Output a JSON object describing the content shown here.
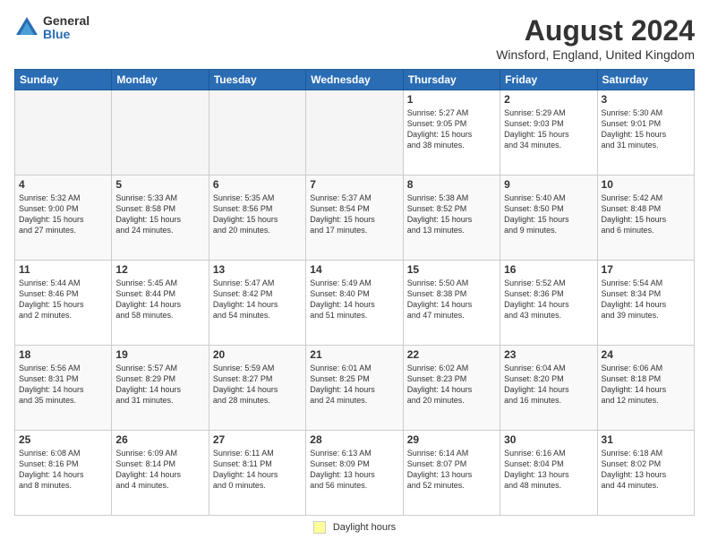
{
  "logo": {
    "general": "General",
    "blue": "Blue"
  },
  "title": "August 2024",
  "subtitle": "Winsford, England, United Kingdom",
  "headers": [
    "Sunday",
    "Monday",
    "Tuesday",
    "Wednesday",
    "Thursday",
    "Friday",
    "Saturday"
  ],
  "legend_label": "Daylight hours",
  "weeks": [
    [
      {
        "day": "",
        "info": ""
      },
      {
        "day": "",
        "info": ""
      },
      {
        "day": "",
        "info": ""
      },
      {
        "day": "",
        "info": ""
      },
      {
        "day": "1",
        "info": "Sunrise: 5:27 AM\nSunset: 9:05 PM\nDaylight: 15 hours\nand 38 minutes."
      },
      {
        "day": "2",
        "info": "Sunrise: 5:29 AM\nSunset: 9:03 PM\nDaylight: 15 hours\nand 34 minutes."
      },
      {
        "day": "3",
        "info": "Sunrise: 5:30 AM\nSunset: 9:01 PM\nDaylight: 15 hours\nand 31 minutes."
      }
    ],
    [
      {
        "day": "4",
        "info": "Sunrise: 5:32 AM\nSunset: 9:00 PM\nDaylight: 15 hours\nand 27 minutes."
      },
      {
        "day": "5",
        "info": "Sunrise: 5:33 AM\nSunset: 8:58 PM\nDaylight: 15 hours\nand 24 minutes."
      },
      {
        "day": "6",
        "info": "Sunrise: 5:35 AM\nSunset: 8:56 PM\nDaylight: 15 hours\nand 20 minutes."
      },
      {
        "day": "7",
        "info": "Sunrise: 5:37 AM\nSunset: 8:54 PM\nDaylight: 15 hours\nand 17 minutes."
      },
      {
        "day": "8",
        "info": "Sunrise: 5:38 AM\nSunset: 8:52 PM\nDaylight: 15 hours\nand 13 minutes."
      },
      {
        "day": "9",
        "info": "Sunrise: 5:40 AM\nSunset: 8:50 PM\nDaylight: 15 hours\nand 9 minutes."
      },
      {
        "day": "10",
        "info": "Sunrise: 5:42 AM\nSunset: 8:48 PM\nDaylight: 15 hours\nand 6 minutes."
      }
    ],
    [
      {
        "day": "11",
        "info": "Sunrise: 5:44 AM\nSunset: 8:46 PM\nDaylight: 15 hours\nand 2 minutes."
      },
      {
        "day": "12",
        "info": "Sunrise: 5:45 AM\nSunset: 8:44 PM\nDaylight: 14 hours\nand 58 minutes."
      },
      {
        "day": "13",
        "info": "Sunrise: 5:47 AM\nSunset: 8:42 PM\nDaylight: 14 hours\nand 54 minutes."
      },
      {
        "day": "14",
        "info": "Sunrise: 5:49 AM\nSunset: 8:40 PM\nDaylight: 14 hours\nand 51 minutes."
      },
      {
        "day": "15",
        "info": "Sunrise: 5:50 AM\nSunset: 8:38 PM\nDaylight: 14 hours\nand 47 minutes."
      },
      {
        "day": "16",
        "info": "Sunrise: 5:52 AM\nSunset: 8:36 PM\nDaylight: 14 hours\nand 43 minutes."
      },
      {
        "day": "17",
        "info": "Sunrise: 5:54 AM\nSunset: 8:34 PM\nDaylight: 14 hours\nand 39 minutes."
      }
    ],
    [
      {
        "day": "18",
        "info": "Sunrise: 5:56 AM\nSunset: 8:31 PM\nDaylight: 14 hours\nand 35 minutes."
      },
      {
        "day": "19",
        "info": "Sunrise: 5:57 AM\nSunset: 8:29 PM\nDaylight: 14 hours\nand 31 minutes."
      },
      {
        "day": "20",
        "info": "Sunrise: 5:59 AM\nSunset: 8:27 PM\nDaylight: 14 hours\nand 28 minutes."
      },
      {
        "day": "21",
        "info": "Sunrise: 6:01 AM\nSunset: 8:25 PM\nDaylight: 14 hours\nand 24 minutes."
      },
      {
        "day": "22",
        "info": "Sunrise: 6:02 AM\nSunset: 8:23 PM\nDaylight: 14 hours\nand 20 minutes."
      },
      {
        "day": "23",
        "info": "Sunrise: 6:04 AM\nSunset: 8:20 PM\nDaylight: 14 hours\nand 16 minutes."
      },
      {
        "day": "24",
        "info": "Sunrise: 6:06 AM\nSunset: 8:18 PM\nDaylight: 14 hours\nand 12 minutes."
      }
    ],
    [
      {
        "day": "25",
        "info": "Sunrise: 6:08 AM\nSunset: 8:16 PM\nDaylight: 14 hours\nand 8 minutes."
      },
      {
        "day": "26",
        "info": "Sunrise: 6:09 AM\nSunset: 8:14 PM\nDaylight: 14 hours\nand 4 minutes."
      },
      {
        "day": "27",
        "info": "Sunrise: 6:11 AM\nSunset: 8:11 PM\nDaylight: 14 hours\nand 0 minutes."
      },
      {
        "day": "28",
        "info": "Sunrise: 6:13 AM\nSunset: 8:09 PM\nDaylight: 13 hours\nand 56 minutes."
      },
      {
        "day": "29",
        "info": "Sunrise: 6:14 AM\nSunset: 8:07 PM\nDaylight: 13 hours\nand 52 minutes."
      },
      {
        "day": "30",
        "info": "Sunrise: 6:16 AM\nSunset: 8:04 PM\nDaylight: 13 hours\nand 48 minutes."
      },
      {
        "day": "31",
        "info": "Sunrise: 6:18 AM\nSunset: 8:02 PM\nDaylight: 13 hours\nand 44 minutes."
      }
    ]
  ]
}
